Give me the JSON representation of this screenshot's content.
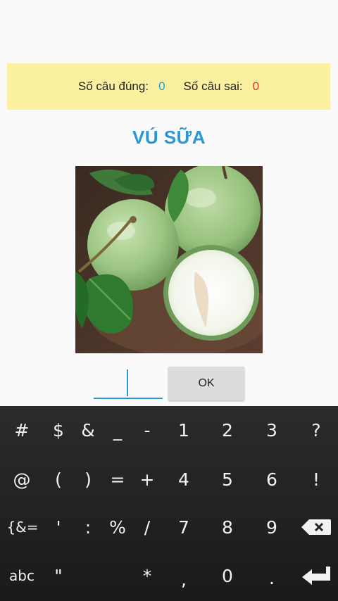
{
  "score": {
    "correct_label": "Số câu đúng:",
    "correct_value": "0",
    "wrong_label": "Số câu sai:",
    "wrong_value": "0"
  },
  "word": "VÚ SỮA",
  "answer_input": {
    "value": ""
  },
  "ok_label": "OK",
  "keyboard": {
    "row1": [
      "#",
      "$",
      "&",
      "_",
      "-",
      "1",
      "2",
      "3",
      "?"
    ],
    "row2": [
      "@",
      "(",
      ")",
      "=",
      "+",
      "4",
      "5",
      "6",
      "!"
    ],
    "row3": [
      "{&=",
      "'",
      ":",
      "%",
      "/",
      "7",
      "8",
      "9"
    ],
    "row4": [
      "abc",
      "\"",
      "*",
      ",",
      "0",
      "."
    ],
    "backspace_icon": "backspace-icon",
    "enter_icon": "enter-icon"
  },
  "colors": {
    "score_bar": "#fbf0a0",
    "word": "#2a97d5",
    "correct": "#1e9bd7",
    "wrong": "#e0302a",
    "keyboard_bg": "#222222"
  }
}
